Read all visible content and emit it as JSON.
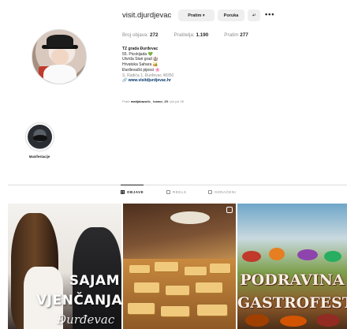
{
  "profile": {
    "username": "visit.djurdjevac",
    "follow_label": "Pratim ▾",
    "message_label": "Poruka",
    "suggest_label": "+²",
    "more_label": "•••",
    "stats": [
      {
        "label": "Broj objava:",
        "value": "272"
      },
      {
        "label": "Pratitelja:",
        "value": "1.190"
      },
      {
        "label": "Pratim",
        "value": "277"
      }
    ],
    "bio": {
      "name": "TZ grada Đurđevac",
      "lines": [
        "55. Picokijada 💚",
        "Utvrda Stari grad 🏰",
        "Hrvatska Sahara 🏜️",
        "Đurđevački pijesci 🌸"
      ],
      "address": "S. Radića 1, Đurđevac 48350",
      "link": "🔗 www.visitdjurdjevac.hr"
    },
    "followed_by": {
      "prefix": "Prate",
      "names": "matijabazulic_ ivanor_25",
      "suffix": "i još još 38"
    }
  },
  "highlights": [
    {
      "label": "Manifestacije"
    }
  ],
  "tabs": [
    {
      "label": "OBJAVE",
      "active": true
    },
    {
      "label": "REELS",
      "active": false
    },
    {
      "label": "OZNAČENI",
      "active": false
    }
  ],
  "posts": [
    {
      "text_lines": [
        "SAJAM",
        "VJENČANJA",
        "Đurđevac"
      ]
    },
    {
      "text_lines": []
    },
    {
      "text_lines": [
        "PODRAVINA",
        "GASTROFEST"
      ]
    }
  ]
}
